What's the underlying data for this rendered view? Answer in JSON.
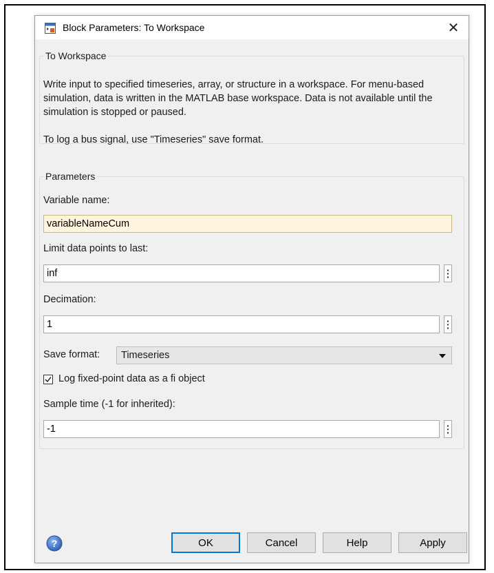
{
  "dialog": {
    "title": "Block Parameters: To Workspace",
    "close_glyph": "✕",
    "icon": "simulink-block-icon"
  },
  "description_group": {
    "title": "To Workspace",
    "paragraph1": "Write input to specified timeseries, array, or structure in a workspace. For menu-based simulation, data is written in the MATLAB base workspace. Data is not available until the simulation is stopped or paused.",
    "paragraph2": "To log a bus signal, use \"Timeseries\" save format."
  },
  "parameters": {
    "title": "Parameters",
    "variable_name_label": "Variable name:",
    "variable_name_value": "variableNameCum",
    "limit_label": "Limit data points to last:",
    "limit_value": "inf",
    "decimation_label": "Decimation:",
    "decimation_value": "1",
    "save_format_label": "Save format:",
    "save_format_value": "Timeseries",
    "log_fixed_point_label": "Log fixed-point data as a fi object",
    "log_fixed_point_checked": true,
    "sample_time_label": "Sample time (-1 for inherited):",
    "sample_time_value": "-1"
  },
  "buttons": {
    "ok": "OK",
    "cancel": "Cancel",
    "help": "Help",
    "apply": "Apply"
  },
  "colors": {
    "active_field": "#fff5dc",
    "default_button_border": "#0078d7",
    "help_icon": "#3a6fc4"
  }
}
